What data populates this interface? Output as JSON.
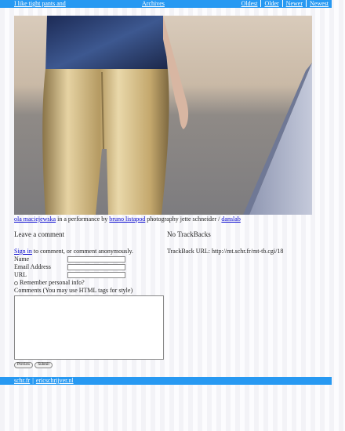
{
  "header": {
    "title": "I like tight pants and",
    "archives": "Archives",
    "nav": [
      "Oldest",
      "Older",
      "Newer",
      "Newest"
    ]
  },
  "photo": {
    "alt": "person in gold metallic pants"
  },
  "caption": {
    "person_link": "ola maciejewska",
    "text1": " in a performance by ",
    "artist_link": "bruno listapod",
    "text2": " photography jette schneider / ",
    "lab_link": "danslab"
  },
  "comments": {
    "heading": "Leave a comment",
    "signin_link": "Sign in",
    "signin_text": " to comment, or comment anonymously.",
    "name_label": "Name",
    "email_label": "Email Address",
    "url_label": "URL",
    "remember_label": "Remember personal info?",
    "comments_label": "Comments (You may use HTML tags for style)",
    "preview_button": "Preview",
    "submit_button": "Submit"
  },
  "trackbacks": {
    "heading": "No TrackBacks",
    "url_text": "TrackBack URL: http://mt.schr.fr/mt-tb.cgi/18"
  },
  "footer": {
    "link1": "schr.fr",
    "separator": "|",
    "link2": "ericschrijver.nl"
  },
  "colors": {
    "bar": "#2799f2",
    "link": "#0000cc"
  }
}
